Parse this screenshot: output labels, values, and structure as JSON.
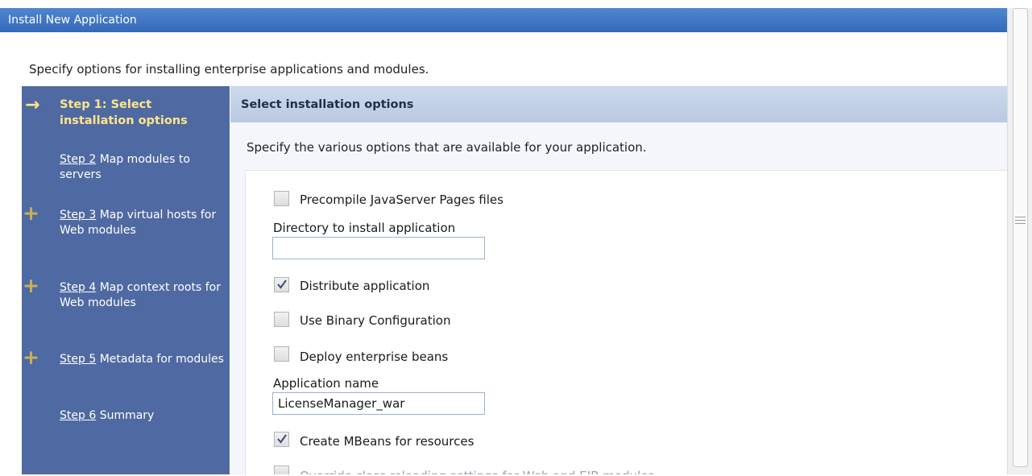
{
  "window": {
    "title": "Install New Application"
  },
  "intro": "Specify options for installing enterprise applications and modules.",
  "steps": [
    {
      "id": "1",
      "text": "Step 1: Select installation options",
      "current": true
    },
    {
      "link": "Step 2",
      "text": "Map modules to servers"
    },
    {
      "link": "Step 3",
      "text": "Map virtual hosts for Web modules"
    },
    {
      "link": "Step 4",
      "text": "Map context roots for Web modules"
    },
    {
      "link": "Step 5",
      "text": "Metadata for modules"
    },
    {
      "link": "Step 6",
      "text": "Summary"
    }
  ],
  "panel": {
    "header": "Select installation options",
    "description": "Specify the various options that are available for your application."
  },
  "options": {
    "precompile_jsp": {
      "label": "Precompile JavaServer Pages files",
      "checked": false
    },
    "install_directory": {
      "label": "Directory to install application",
      "value": ""
    },
    "distribute_application": {
      "label": "Distribute application",
      "checked": true
    },
    "use_binary_configuration": {
      "label": "Use Binary Configuration",
      "checked": false
    },
    "deploy_enterprise_beans": {
      "label": "Deploy enterprise beans",
      "checked": false
    },
    "application_name": {
      "label": "Application name",
      "value": "LicenseManager_war"
    },
    "create_mbeans": {
      "label": "Create MBeans for resources",
      "checked": true
    },
    "override_class_reloading": {
      "label": "Override class reloading settings for Web and EJB modules",
      "checked": false
    }
  }
}
